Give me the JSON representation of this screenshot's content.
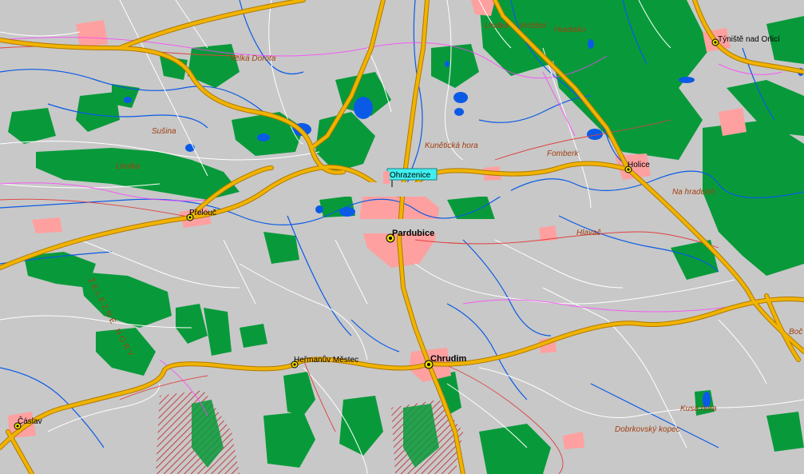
{
  "map": {
    "colors": {
      "land": "#c8c8c8",
      "forest": "#089a3a",
      "urban": "#ffa0a0",
      "water": "#0a5ae6",
      "road_major": "#f0b400",
      "road_major_edge": "#b07800",
      "road_minor": "#ffffff",
      "road_regional": "#e04040",
      "border": "#ff40ff",
      "label_italic": "#a04010",
      "protected": "#c01818"
    },
    "cities": [
      {
        "name": "Pardubice",
        "tag": "city-pardubice"
      },
      {
        "name": "Chrudim",
        "tag": "city-chrudim"
      }
    ],
    "towns": [
      {
        "name": "Týniště nad Orlicí",
        "tag": "town-tyniste"
      },
      {
        "name": "Holice",
        "tag": "town-holice"
      },
      {
        "name": "Přelouč",
        "tag": "town-prelouc"
      },
      {
        "name": "Heřmanův Městec",
        "tag": "town-hermanuv-mestec"
      },
      {
        "name": "Čáslav",
        "tag": "town-caslav"
      }
    ],
    "places": [
      {
        "name": "Lhotka",
        "tag": "place-lhotka-top"
      },
      {
        "name": "Vrchbol",
        "tag": "place-vrchbol"
      },
      {
        "name": "Hradisko",
        "tag": "place-hradisko"
      },
      {
        "name": "Velká Dorota",
        "tag": "place-velka-dorota"
      },
      {
        "name": "Sušina",
        "tag": "place-susina"
      },
      {
        "name": "Lhotka",
        "tag": "place-lhotka-left"
      },
      {
        "name": "Kunětická hora",
        "tag": "place-kuneticka-hora"
      },
      {
        "name": "Fomberk",
        "tag": "place-fomberk"
      },
      {
        "name": "Na hradcích",
        "tag": "place-na-hradcich"
      },
      {
        "name": "Hlavač",
        "tag": "place-hlavac"
      },
      {
        "name": "Kusá hora",
        "tag": "place-kusa-hora"
      },
      {
        "name": "Dobrkovský kopec",
        "tag": "place-dobrkovsky-kopec"
      },
      {
        "name": "Boč",
        "tag": "place-boc"
      }
    ],
    "ranges": [
      {
        "name": "ŽELEZNÉ HORY",
        "tag": "range-zelezne-hory"
      }
    ],
    "highlight": {
      "name": "Ohrazenice",
      "tag": "highlight-ohrazenice"
    }
  }
}
